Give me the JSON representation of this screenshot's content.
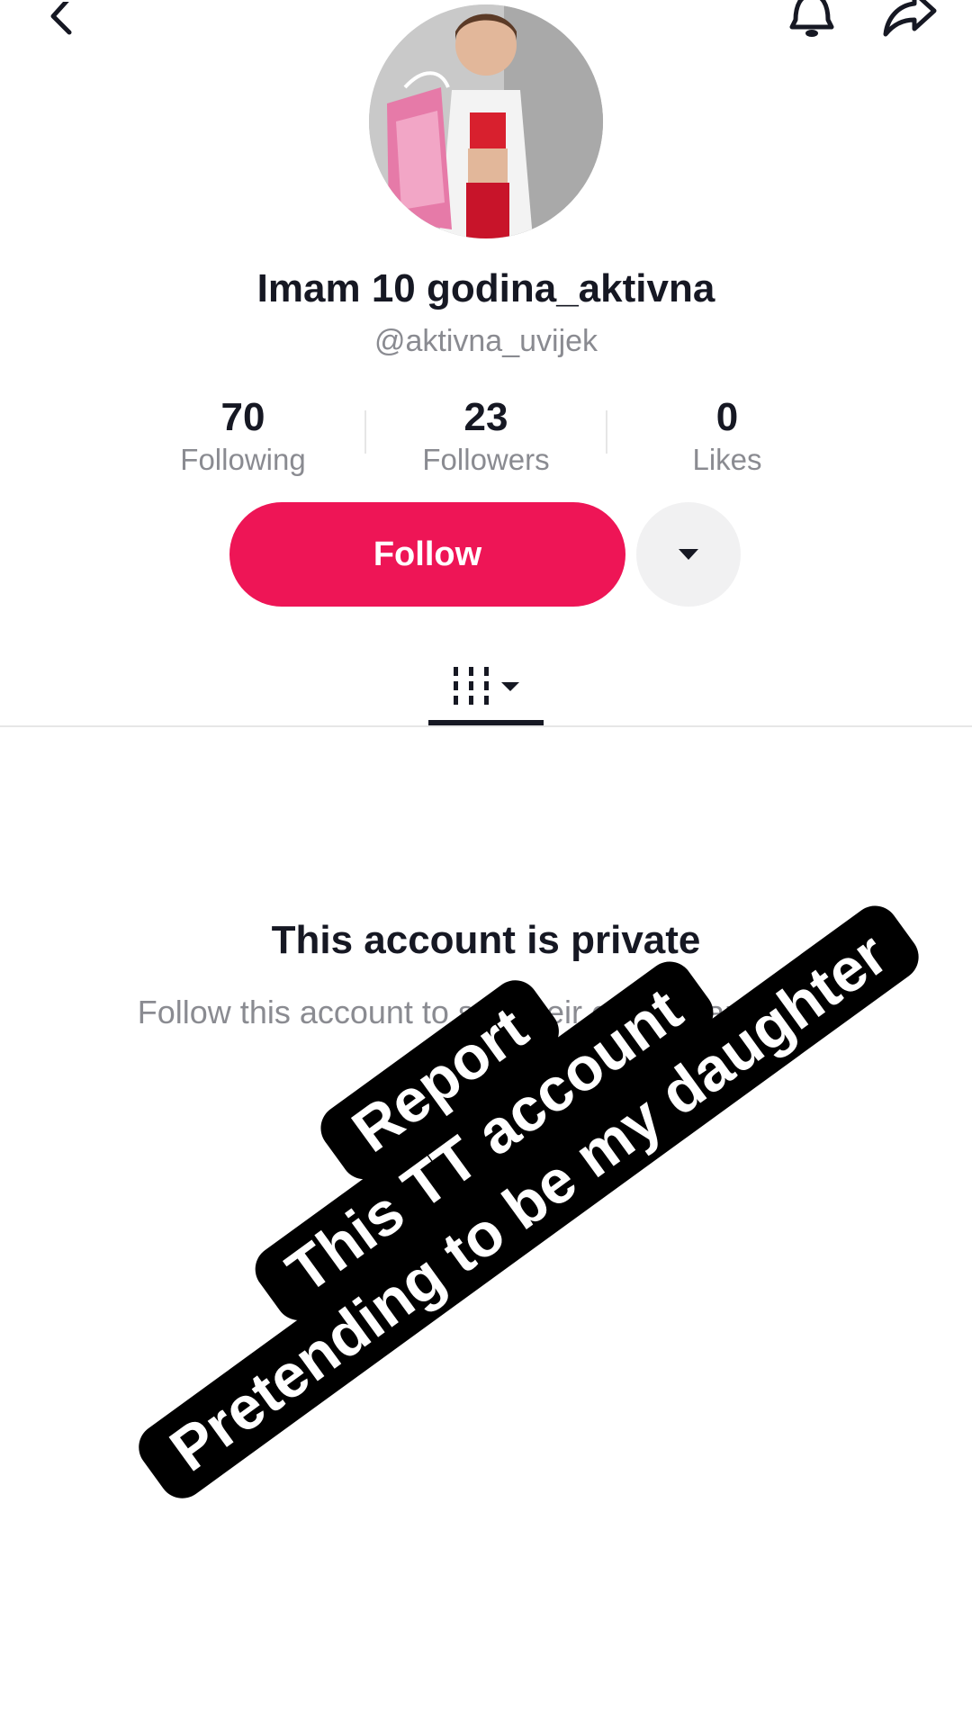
{
  "profile": {
    "display_name": "Imam 10 godina_aktivna",
    "handle": "@aktivna_uvijek"
  },
  "stats": [
    {
      "value": "70",
      "label": "Following"
    },
    {
      "value": "23",
      "label": "Followers"
    },
    {
      "value": "0",
      "label": "Likes"
    }
  ],
  "actions": {
    "follow_label": "Follow"
  },
  "private_notice": {
    "title": "This account is private",
    "subtitle": "Follow this account to see their content and likes"
  },
  "overlay": {
    "lines": [
      "Report",
      "This TT account",
      "Pretending to be my daughter"
    ]
  },
  "icons": {
    "back": "chevron-left-icon",
    "notifications": "bell-icon",
    "share": "share-arrow-icon",
    "more": "caret-down-icon",
    "videos_tab": "grid-columns-icon"
  },
  "colors": {
    "follow_button": "#ee1556",
    "text_primary": "#161823",
    "text_secondary": "#8a8b91",
    "overlay_bg": "#000000",
    "overlay_text": "#ffffff"
  }
}
